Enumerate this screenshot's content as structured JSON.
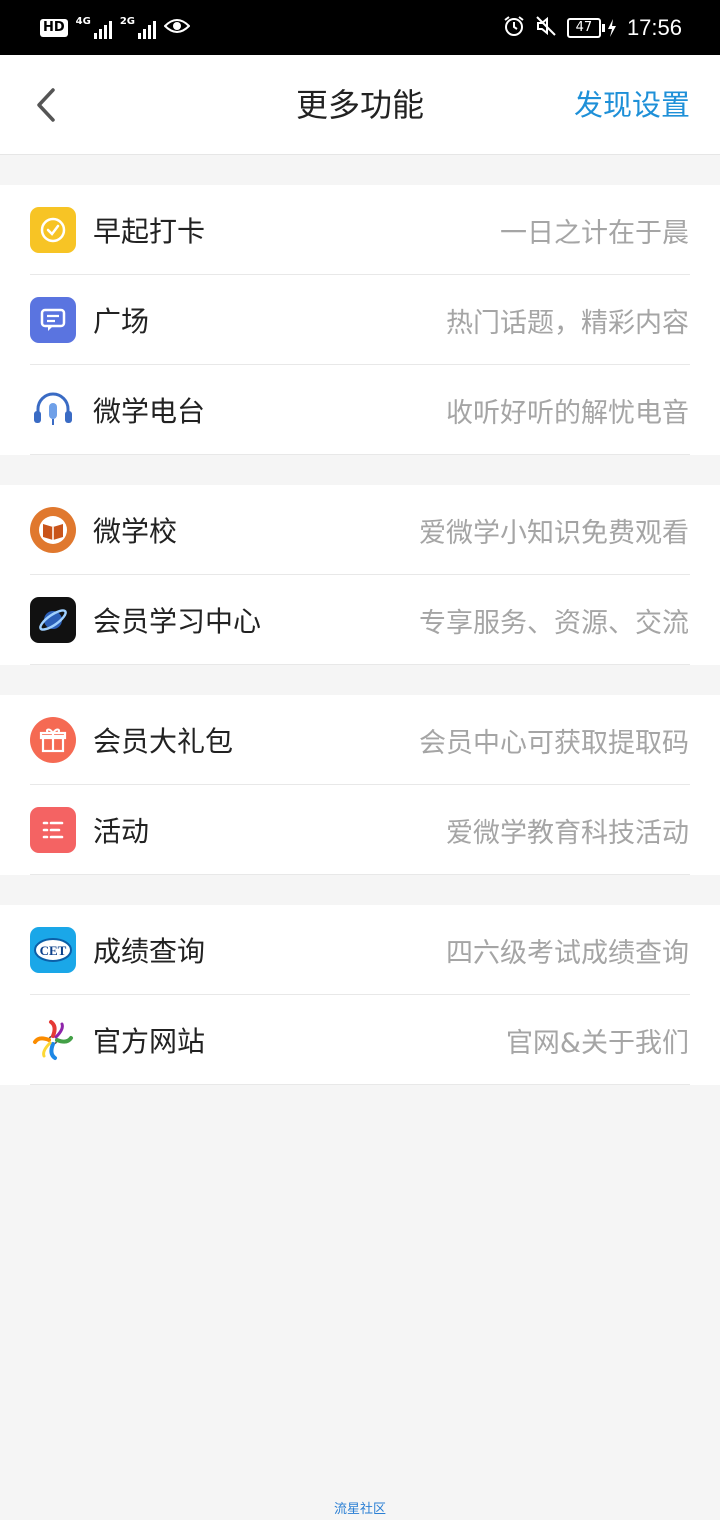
{
  "status_bar": {
    "hd": "HD",
    "net1": "4G",
    "net2": "2G",
    "battery": "47",
    "time": "17:56"
  },
  "navbar": {
    "title": "更多功能",
    "action": "发现设置"
  },
  "groups": [
    {
      "items": [
        {
          "label": "早起打卡",
          "desc": "一日之计在于晨",
          "icon": "alarm-check-icon",
          "color": "#f7c425"
        },
        {
          "label": "广场",
          "desc": "热门话题，精彩内容",
          "icon": "chat-bubble-icon",
          "color": "#5a74e0"
        },
        {
          "label": "微学电台",
          "desc": "收听好听的解忧电音",
          "icon": "headphones-mic-icon",
          "color": "#ffffff"
        }
      ]
    },
    {
      "items": [
        {
          "label": "微学校",
          "desc": "爱微学小知识免费观看",
          "icon": "open-book-icon",
          "color": "#e0782e"
        },
        {
          "label": "会员学习中心",
          "desc": "专享服务、资源、交流",
          "icon": "planet-logo-icon",
          "color": "#111111"
        }
      ]
    },
    {
      "items": [
        {
          "label": "会员大礼包",
          "desc": "会员中心可获取提取码",
          "icon": "gift-icon",
          "color": "#f56a53"
        },
        {
          "label": "活动",
          "desc": "爱微学教育科技活动",
          "icon": "list-icon",
          "color": "#f46363"
        }
      ]
    },
    {
      "items": [
        {
          "label": "成绩查询",
          "desc": "四六级考试成绩查询",
          "icon": "cet-logo-icon",
          "color": "#1aa7e8",
          "logo_text": "CET"
        },
        {
          "label": "官方网站",
          "desc": "官网&关于我们",
          "icon": "pinwheel-logo-icon",
          "color": "#ffffff"
        }
      ]
    }
  ],
  "watermark": "流星社区"
}
